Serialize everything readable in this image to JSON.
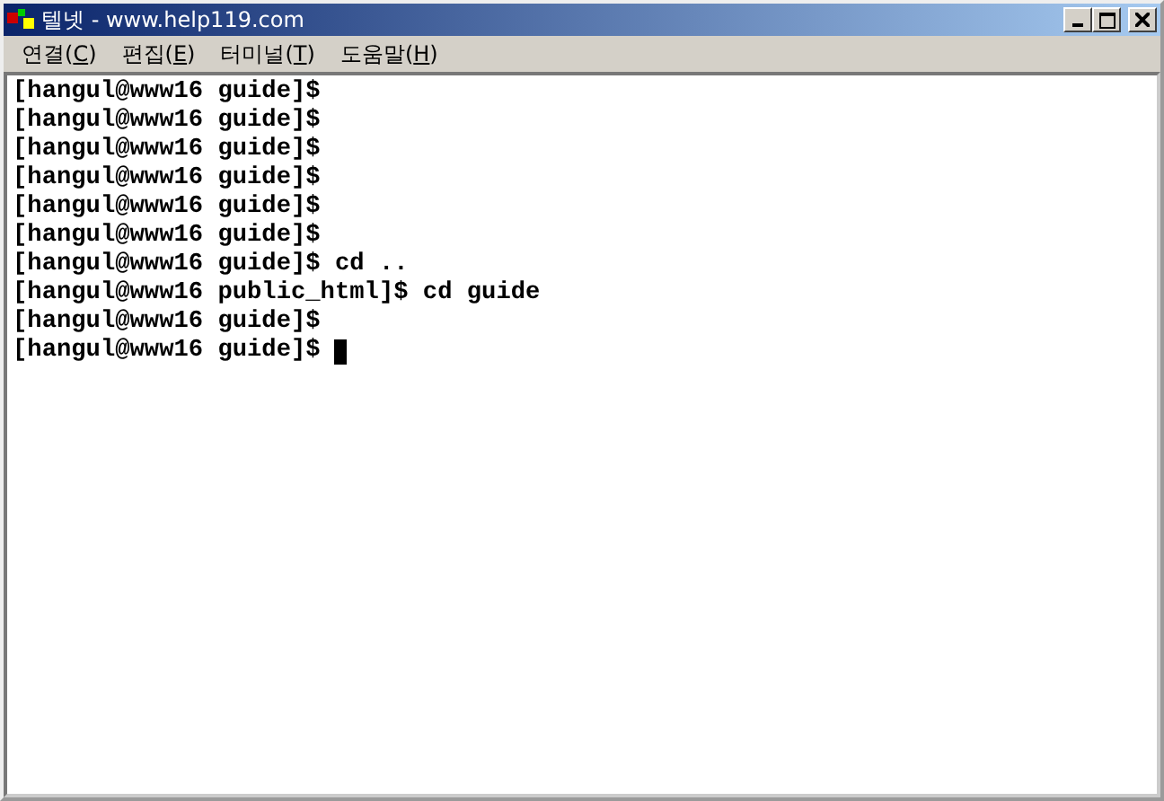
{
  "window": {
    "title": "텔넷 - www.help119.com"
  },
  "menu": [
    {
      "before": "연결(",
      "key": "C",
      "after": ")"
    },
    {
      "before": "편집(",
      "key": "E",
      "after": ")"
    },
    {
      "before": "터미널(",
      "key": "T",
      "after": ")"
    },
    {
      "before": "도움말(",
      "key": "H",
      "after": ")"
    }
  ],
  "terminal": {
    "lines": [
      "[hangul@www16 guide]$",
      "[hangul@www16 guide]$",
      "[hangul@www16 guide]$",
      "[hangul@www16 guide]$",
      "[hangul@www16 guide]$",
      "[hangul@www16 guide]$",
      "[hangul@www16 guide]$ cd ..",
      "[hangul@www16 public_html]$ cd guide",
      "[hangul@www16 guide]$",
      "[hangul@www16 guide]$"
    ],
    "cursor_on_last_line": true
  }
}
